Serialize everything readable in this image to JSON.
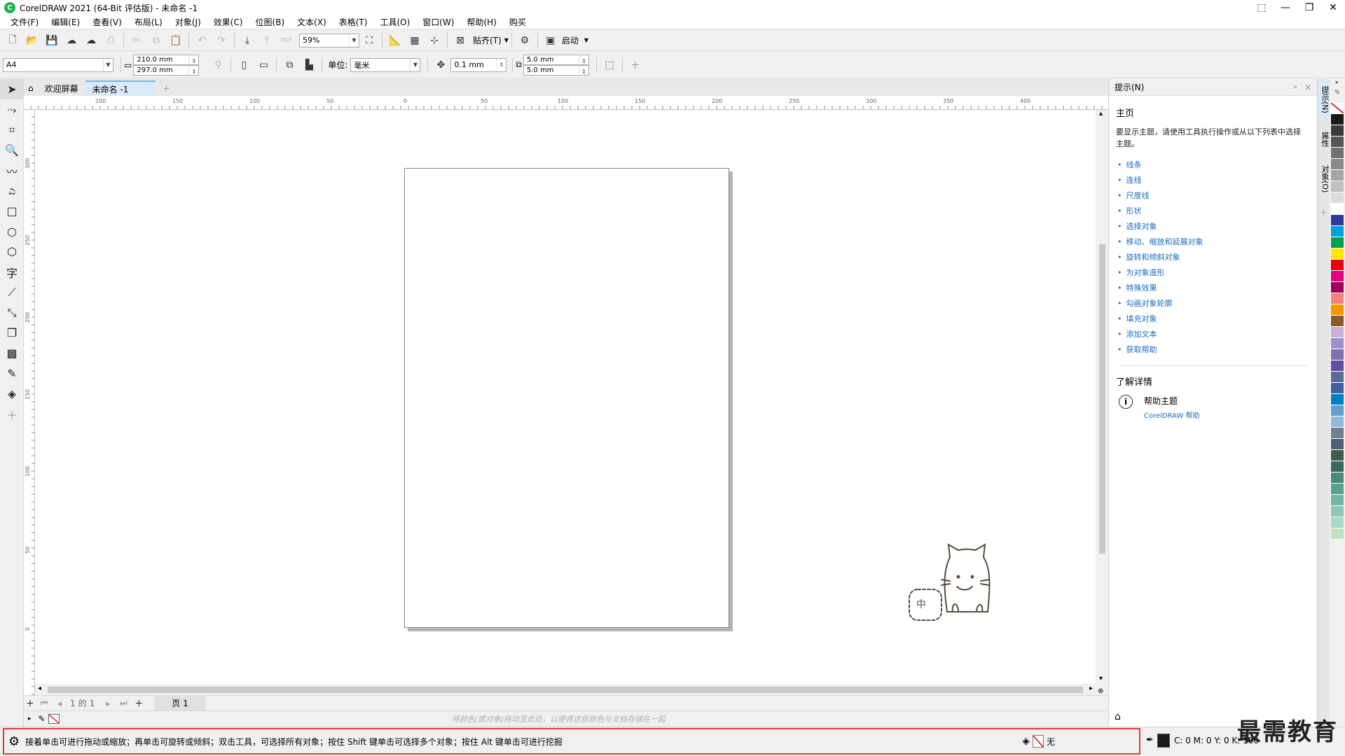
{
  "window": {
    "title": "CorelDRAW 2021 (64-Bit 评估版) - 未命名 -1",
    "logo_glyph": "C"
  },
  "menu": [
    "文件(F)",
    "编辑(E)",
    "查看(V)",
    "布局(L)",
    "对象(J)",
    "效果(C)",
    "位图(B)",
    "文本(X)",
    "表格(T)",
    "工具(O)",
    "窗口(W)",
    "帮助(H)",
    "购买"
  ],
  "toolbar1": {
    "zoom": "59%",
    "snap_label": "贴齐(T)",
    "launch_label": "启动",
    "pdf_label": "PDF"
  },
  "toolbar2": {
    "page_size": "A4",
    "width": "210.0 mm",
    "height": "297.0 mm",
    "unit_label": "单位:",
    "unit_value": "毫米",
    "nudge": "0.1 mm",
    "dup_x": "5.0 mm",
    "dup_y": "5.0 mm"
  },
  "doc_tabs": {
    "home": "欢迎屏幕",
    "doc": "未命名 -1"
  },
  "ruler": {
    "h_labels": [
      "200",
      "150",
      "100",
      "50",
      "0",
      "50",
      "100",
      "150",
      "200",
      "250",
      "300",
      "350",
      "400"
    ],
    "v_labels": [
      "300",
      "250",
      "200",
      "150",
      "100",
      "50",
      "0"
    ],
    "unit": "毫米"
  },
  "page_nav": {
    "current": "1",
    "of_label": "的",
    "total": "1",
    "page_tab": "页 1"
  },
  "color_hint": "将颜色(或对象)拖动至此处，以便将这些颜色与文档存储在一起",
  "docker": {
    "header": "提示(N)",
    "home_title": "主页",
    "description": "要显示主题，请使用工具执行操作或从以下列表中选择主题。",
    "topics": [
      "线条",
      "连线",
      "尺度线",
      "形状",
      "选择对象",
      "移动、缩放和延展对象",
      "旋转和倾斜对象",
      "为对象造形",
      "特殊效果",
      "勾画对象轮廓",
      "填充对象",
      "添加文本",
      "获取帮助"
    ],
    "learn_title": "了解详情",
    "help_topics": "帮助主题",
    "help_link": "CorelDRAW 帮助"
  },
  "vtabs": [
    "提示(N)",
    "属性",
    "对象(O)"
  ],
  "palette": [
    "#ffffff",
    "#1a1a1a",
    "#3a3a3a",
    "#555555",
    "#707070",
    "#8a8a8a",
    "#a5a5a5",
    "#c0c0c0",
    "#dcdcdc",
    "#ffffff",
    "#2a3a9a",
    "#00a0e0",
    "#00a050",
    "#ffe600",
    "#e60012",
    "#e4007f",
    "#a0005a",
    "#f08080",
    "#f39800",
    "#8b5a2b",
    "#c8b0d8",
    "#a090c8",
    "#8070b0",
    "#6050a0",
    "#5a6a9a",
    "#4060a0",
    "#0080c0",
    "#60a0d0",
    "#90b8d8",
    "#708090",
    "#506070",
    "#405a50",
    "#3a6a5a",
    "#4a8a7a",
    "#5aa090",
    "#70b8a8",
    "#90c8b8",
    "#a8d8c8",
    "#c0e0c0"
  ],
  "status": {
    "hint": "接着单击可进行拖动或缩放；再单击可旋转或倾斜；双击工具，可选择所有对象；按住 Shift 键单击可选择多个对象；按住 Alt 键单击可进行挖掘",
    "fill_label": "无",
    "color_values": "C: 0 M: 0 Y: 0 K: 100"
  },
  "mascot": {
    "badge_text": "中",
    "color": "#5a4a42"
  },
  "watermark": "最需教育"
}
